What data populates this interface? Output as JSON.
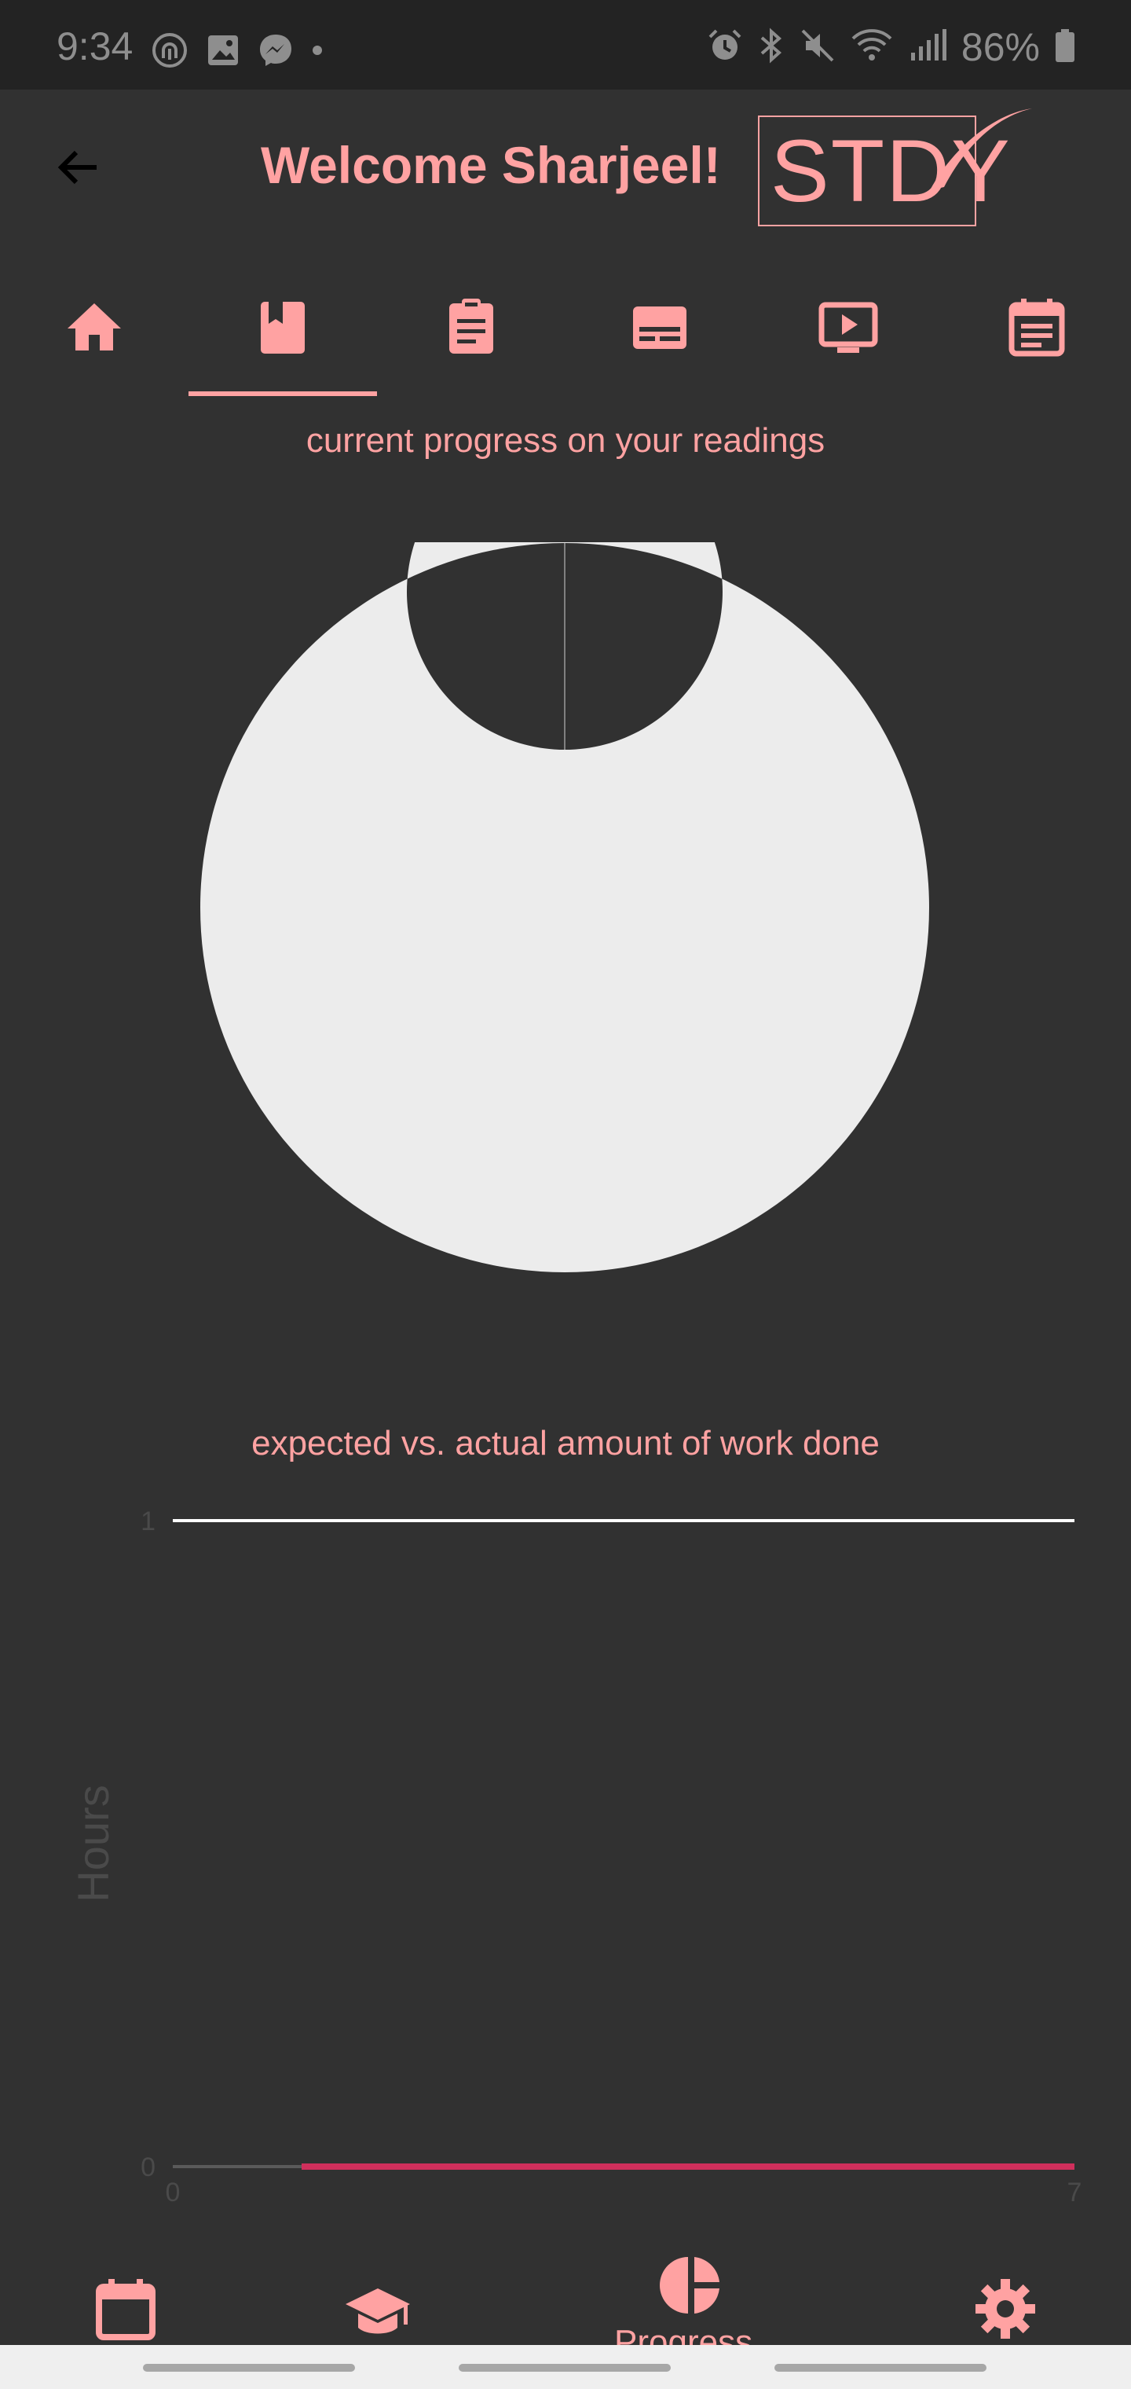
{
  "status_bar": {
    "time": "9:34",
    "battery": "86%",
    "left_icons": [
      "fingerprint-icon",
      "image-icon",
      "messenger-icon",
      "dot-icon"
    ],
    "right_icons": [
      "alarm-icon",
      "bluetooth-icon",
      "mute-icon",
      "wifi-icon",
      "signal-icon",
      "battery-icon"
    ]
  },
  "header": {
    "back_icon": "arrow-left-icon",
    "title": "Welcome Sharjeel!",
    "logo_text": "STDY"
  },
  "tabs": {
    "items": [
      {
        "icon": "home-icon",
        "selected": false
      },
      {
        "icon": "book-icon",
        "selected": true
      },
      {
        "icon": "clipboard-icon",
        "selected": false
      },
      {
        "icon": "subtitles-icon",
        "selected": false
      },
      {
        "icon": "video-icon",
        "selected": false
      },
      {
        "icon": "calendar-text-icon",
        "selected": false
      }
    ]
  },
  "readings": {
    "title": "current progress on your readings"
  },
  "work": {
    "title": "expected vs. actual amount of work done"
  },
  "chart_data": [
    {
      "type": "pie",
      "title": "current progress on your readings",
      "donut": true,
      "values": [
        1
      ],
      "colors": [
        "#ececec"
      ]
    },
    {
      "type": "line",
      "title": "expected vs. actual amount of work done",
      "xlabel": "",
      "ylabel": "Hours",
      "xlim": [
        0,
        7
      ],
      "ylim": [
        0,
        1
      ],
      "x_ticks": [
        "0",
        "7"
      ],
      "y_ticks": [
        "0",
        "1"
      ],
      "series": [
        {
          "color": "#ffffff",
          "x": [
            0,
            7
          ],
          "y": [
            1,
            1
          ]
        },
        {
          "color": "#d02f5c",
          "x": [
            1,
            7
          ],
          "y": [
            0,
            0
          ]
        }
      ]
    }
  ],
  "bottom_nav": {
    "items": [
      {
        "icon": "calendar-icon"
      },
      {
        "icon": "graduation-cap-icon"
      },
      {
        "icon": "pie-chart-icon",
        "label": "Progress"
      },
      {
        "icon": "settings-icon"
      }
    ]
  },
  "colors": {
    "background": "#313131",
    "accent": "#ffa2a2",
    "status_bar": "#232323",
    "chart_fill": "#ececec",
    "actual_line": "#d02f5c"
  }
}
